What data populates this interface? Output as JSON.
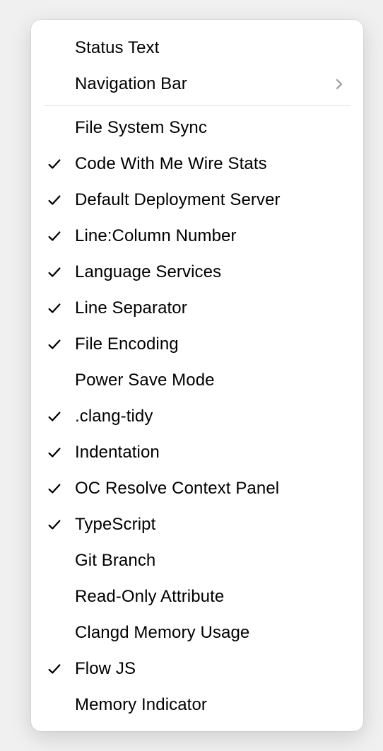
{
  "menu": {
    "sections": [
      {
        "items": [
          {
            "id": "status-text",
            "label": "Status Text",
            "checked": false,
            "hasSubmenu": false
          },
          {
            "id": "navigation-bar",
            "label": "Navigation Bar",
            "checked": false,
            "hasSubmenu": true
          }
        ]
      },
      {
        "items": [
          {
            "id": "file-system-sync",
            "label": "File System Sync",
            "checked": false,
            "hasSubmenu": false
          },
          {
            "id": "code-with-me-wire-stats",
            "label": "Code With Me Wire Stats",
            "checked": true,
            "hasSubmenu": false
          },
          {
            "id": "default-deployment-server",
            "label": "Default Deployment Server",
            "checked": true,
            "hasSubmenu": false
          },
          {
            "id": "line-column-number",
            "label": "Line:Column Number",
            "checked": true,
            "hasSubmenu": false
          },
          {
            "id": "language-services",
            "label": "Language Services",
            "checked": true,
            "hasSubmenu": false
          },
          {
            "id": "line-separator",
            "label": "Line Separator",
            "checked": true,
            "hasSubmenu": false
          },
          {
            "id": "file-encoding",
            "label": "File Encoding",
            "checked": true,
            "hasSubmenu": false
          },
          {
            "id": "power-save-mode",
            "label": "Power Save Mode",
            "checked": false,
            "hasSubmenu": false
          },
          {
            "id": "clang-tidy",
            "label": ".clang-tidy",
            "checked": true,
            "hasSubmenu": false
          },
          {
            "id": "indentation",
            "label": "Indentation",
            "checked": true,
            "hasSubmenu": false
          },
          {
            "id": "oc-resolve-context-panel",
            "label": "OC Resolve Context Panel",
            "checked": true,
            "hasSubmenu": false
          },
          {
            "id": "typescript",
            "label": "TypeScript",
            "checked": true,
            "hasSubmenu": false
          },
          {
            "id": "git-branch",
            "label": "Git Branch",
            "checked": false,
            "hasSubmenu": false
          },
          {
            "id": "read-only-attribute",
            "label": "Read-Only Attribute",
            "checked": false,
            "hasSubmenu": false
          },
          {
            "id": "clangd-memory-usage",
            "label": "Clangd Memory Usage",
            "checked": false,
            "hasSubmenu": false
          },
          {
            "id": "flow-js",
            "label": "Flow JS",
            "checked": true,
            "hasSubmenu": false
          },
          {
            "id": "memory-indicator",
            "label": "Memory Indicator",
            "checked": false,
            "hasSubmenu": false
          }
        ]
      }
    ]
  }
}
